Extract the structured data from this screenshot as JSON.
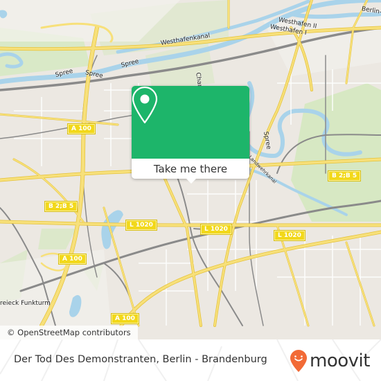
{
  "map": {
    "labels": {
      "westhafenkanal": "Westhafenkanal",
      "westhafen_2": "Westhafen II",
      "westhafen_1": "Westhafen I",
      "berlin_partial": "Berlin-S",
      "spree_1": "Spree",
      "spree_2": "Spree",
      "spree_3": "Spree",
      "spree_4": "Spree",
      "charlottenburger": "Charlottenburger V",
      "landwehrkanal": "Landwehrkanal",
      "dreieck_funkturm": "reieck Funkturm"
    },
    "road_shields": [
      {
        "id": "a100-top",
        "text": "A 100"
      },
      {
        "id": "b2b5-left",
        "text": "B 2;B 5"
      },
      {
        "id": "b2b5-right",
        "text": "B 2;B 5"
      },
      {
        "id": "l1020-1",
        "text": "L 1020"
      },
      {
        "id": "l1020-2",
        "text": "L 1020"
      },
      {
        "id": "l1020-3",
        "text": "L 1020"
      },
      {
        "id": "a100-left",
        "text": "A 100"
      },
      {
        "id": "a100-bottom",
        "text": "A 100"
      }
    ],
    "colors": {
      "land": "#ece8e2",
      "water": "#a9d3ea",
      "park": "#d5e8c0",
      "road": "#f5dd5e",
      "rail": "#8a8a8a"
    }
  },
  "popup": {
    "button_label": "Take me there",
    "color": "#1db56a",
    "icon": "map-pin-icon"
  },
  "attribution": "© OpenStreetMap contributors",
  "footer": {
    "title": "Der Tod Des Demonstranten, Berlin - Brandenburg",
    "brand": "moovit",
    "brand_color": "#f26a36"
  }
}
